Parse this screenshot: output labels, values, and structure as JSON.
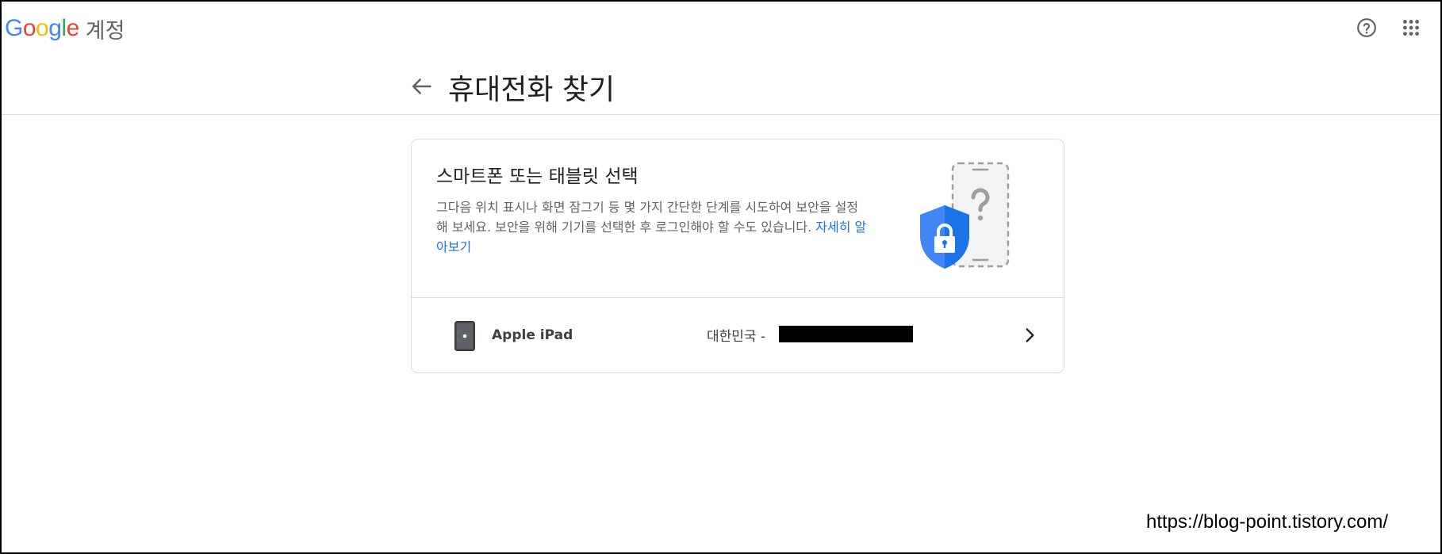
{
  "header": {
    "logo_letters": [
      "G",
      "o",
      "o",
      "g",
      "l",
      "e"
    ],
    "logo_colors": [
      "#4285F4",
      "#EA4335",
      "#FBBC05",
      "#4285F4",
      "#34A853",
      "#EA4335"
    ],
    "product_name": "계정",
    "help_icon": "help-circle-icon",
    "apps_icon": "apps-grid-icon"
  },
  "page": {
    "back_icon": "arrow-back-icon",
    "title": "휴대전화 찾기"
  },
  "card": {
    "title": "스마트폰 또는 태블릿 선택",
    "description": "그다음 위치 표시나 화면 잠그기 등 몇 가지 간단한 단계를 시도하여 보안을 설정해 보세요. 보안을 위해 기기를 선택한 후 로그인해야 할 수도 있습니다.",
    "learn_more": "자세히 알아보기",
    "illustration": "phone-shield-lock-illustration",
    "colors": {
      "shield": "#4285F4",
      "link": "#1a73e8",
      "phone_outline": "#9e9e9e"
    }
  },
  "devices": [
    {
      "name": "Apple iPad",
      "country_prefix": "대한민국 -",
      "icon": "tablet-icon",
      "chevron": "chevron-right-icon"
    }
  ],
  "watermark": "https://blog-point.tistory.com/"
}
